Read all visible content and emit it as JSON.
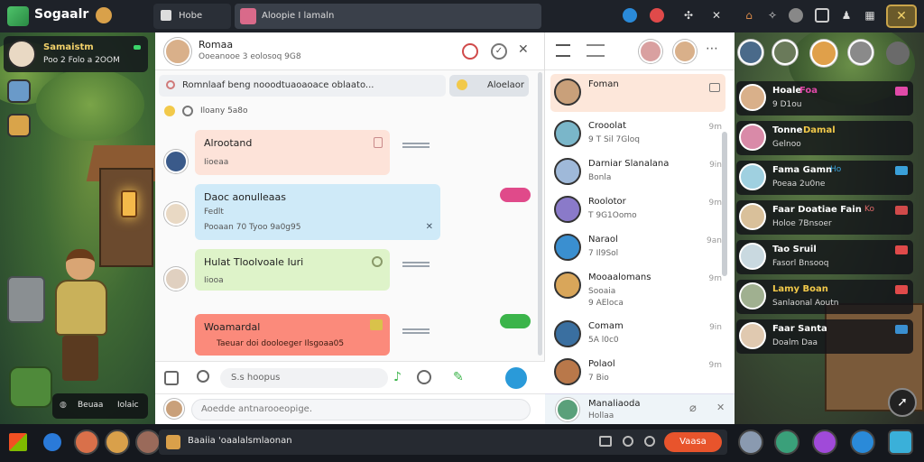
{
  "app": {
    "name": "Sogaalr"
  },
  "tabs": [
    {
      "label": "Hobe"
    },
    {
      "label": "Aloopie I lamaln"
    }
  ],
  "player_status": {
    "name": "Samaistm",
    "subtitle": "Poo 2 Folo a 2OOM"
  },
  "left_badge": {
    "label": "Beuaa",
    "value": "Iolaic"
  },
  "chat": {
    "contact_name": "Romaa",
    "contact_status": "Ooeanooe 3 eolosoq 9G8",
    "pinned_text": "Romnlaaf beng nooodtuaoaoace oblaato...",
    "pinned_right": "Aloelaor",
    "meta_text": "Iloany 5a8o",
    "messages": [
      {
        "title": "Alrootand",
        "subtitle": "Iioeaa",
        "color": "#fde3d9"
      },
      {
        "title": "Daoc aonulleaas",
        "subtitle": "Fedlt",
        "line2": "Pooaan 70 Tyoo 9a0g95",
        "color": "#cfeaf8"
      },
      {
        "title": "Hulat Tloolvoale Iuri",
        "subtitle": "Iiooa",
        "color": "#def3c9"
      },
      {
        "title": "Woamardal",
        "subtitle": "Taeuar doi dooloeger Ilsgoaa05",
        "color": "#fb8a7b"
      }
    ],
    "search_placeholder": "S.s hoopus",
    "message_placeholder": "Aoedde antnarooeopige."
  },
  "contacts": [
    {
      "name": "Foman",
      "status": "",
      "time": "",
      "active": true,
      "color": "#c9a07a"
    },
    {
      "name": "Crooolat",
      "status": "9 T Sil 7Gloq",
      "time": "9m",
      "active": false,
      "color": "#7ab6c9"
    },
    {
      "name": "Darniar Slanalana",
      "status": "Bonla",
      "time": "9in",
      "active": false,
      "color": "#9fb9d9"
    },
    {
      "name": "Roolotor",
      "status": "T 9G1Oomo",
      "time": "9m",
      "active": false,
      "color": "#8a7ac9"
    },
    {
      "name": "Naraol",
      "status": "7 Il9Sol",
      "time": "9an",
      "active": false,
      "color": "#3a8fd0"
    },
    {
      "name": "Mooaalomans",
      "status": "Sooaia",
      "line2": "9 AEloca",
      "time": "9m",
      "active": false,
      "color": "#d9a65a"
    },
    {
      "name": "Comam",
      "status": "5A l0c0",
      "time": "9in",
      "active": false,
      "color": "#3a6fa0"
    },
    {
      "name": "Polaol",
      "status": "7 Bio",
      "time": "9m",
      "active": false,
      "color": "#b9784a"
    },
    {
      "name": "Manaliaoda",
      "status": "Hollaa",
      "time": "",
      "active": false,
      "color": "#5aa07a"
    }
  ],
  "friends": [
    {
      "name": "Hoale",
      "tag": "Foa",
      "status": "9 D1ou",
      "tag_color": "#e04aa8",
      "color": "#d9b08a"
    },
    {
      "name": "Tonne",
      "tag": "Damal",
      "status": "Gelnoo",
      "tag_color": "#f2c94a",
      "color": "#d98aa8"
    },
    {
      "name": "Fama Gamn",
      "tag": "Ho",
      "status": "Poeaa 2u0ne",
      "tag_color": "#3aa0d9",
      "color": "#9fd0e0"
    },
    {
      "name": "Faar Doatiae Fain",
      "tag": "Ko",
      "status": "Holoe 7Bnsoer",
      "tag_color": "#d04a4a",
      "color": "#d9c09a"
    },
    {
      "name": "Tao Sruil",
      "tag": "",
      "status": "Fasorl Bnsooq",
      "tag_color": "#e04a4a",
      "color": "#c9d9e0"
    },
    {
      "name": "Lamy Boan",
      "tag": "",
      "status": "Sanlaonal Aoutn",
      "tag_color": "#e04a4a",
      "color": "#a0b090"
    },
    {
      "name": "Faar Santa",
      "tag": "",
      "status": "Doalm Daa",
      "tag_color": "#3a8fd0",
      "color": "#e0c9b0"
    }
  ],
  "notification": {
    "text": "Baaiia 'oaalalsmlaonan",
    "button": "Vaasa"
  }
}
